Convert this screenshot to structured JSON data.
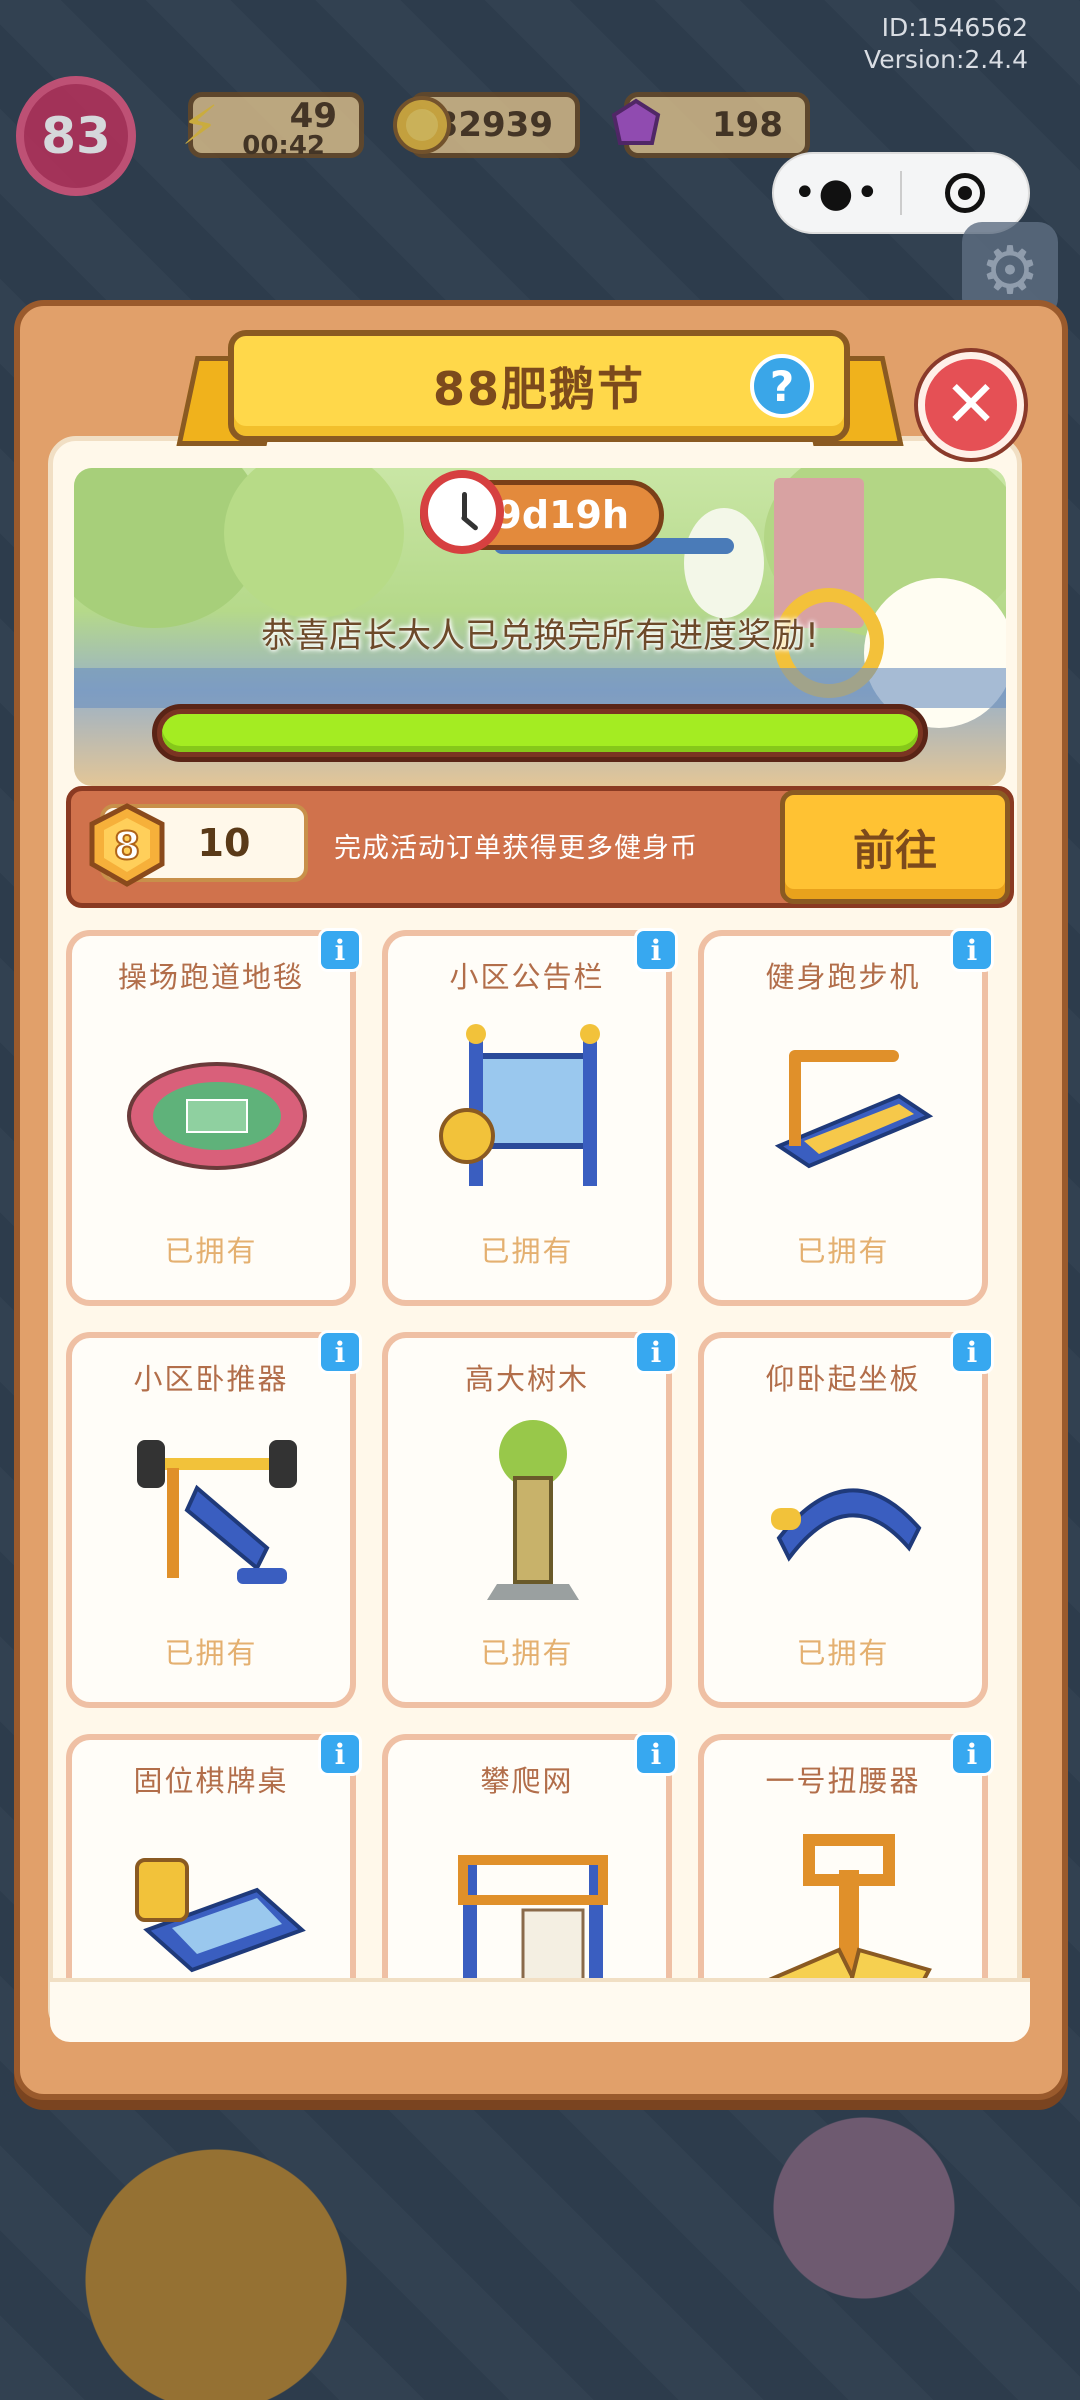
{
  "hud": {
    "id_text": "ID:1546562",
    "version_text": "Version:2.4.4",
    "level": "83",
    "energy": "49",
    "energy_timer": "00:42",
    "coins": "32939",
    "gems": "198"
  },
  "event": {
    "title": "88肥鹅节",
    "help_symbol": "?",
    "close_symbol": "✕",
    "timer": "9d19h",
    "congrats": "恭喜店长大人已兑换完所有进度奖励!",
    "progress_fraction": 1.0,
    "coin_icon_value": "8",
    "coin_count": "10",
    "coin_hint": "完成活动订单获得更多健身币",
    "go_label": "前往"
  },
  "items": [
    {
      "name": "操场跑道地毯",
      "status": "已拥有",
      "art": "track-rug"
    },
    {
      "name": "小区公告栏",
      "status": "已拥有",
      "art": "notice-board"
    },
    {
      "name": "健身跑步机",
      "status": "已拥有",
      "art": "treadmill"
    },
    {
      "name": "小区卧推器",
      "status": "已拥有",
      "art": "bench-press"
    },
    {
      "name": "高大树木",
      "status": "已拥有",
      "art": "tall-tree"
    },
    {
      "name": "仰卧起坐板",
      "status": "已拥有",
      "art": "situp-board"
    },
    {
      "name": "固位棋牌桌",
      "status": "",
      "art": "chess-table"
    },
    {
      "name": "攀爬网",
      "status": "",
      "art": "climbing-net"
    },
    {
      "name": "一号扭腰器",
      "status": "",
      "art": "waist-twister"
    }
  ],
  "colors": {
    "panel": "#e1a06a",
    "ribbon": "#ffd84a",
    "progress": "#a4ec22",
    "close": "#e55055",
    "info": "#37a8f0"
  }
}
